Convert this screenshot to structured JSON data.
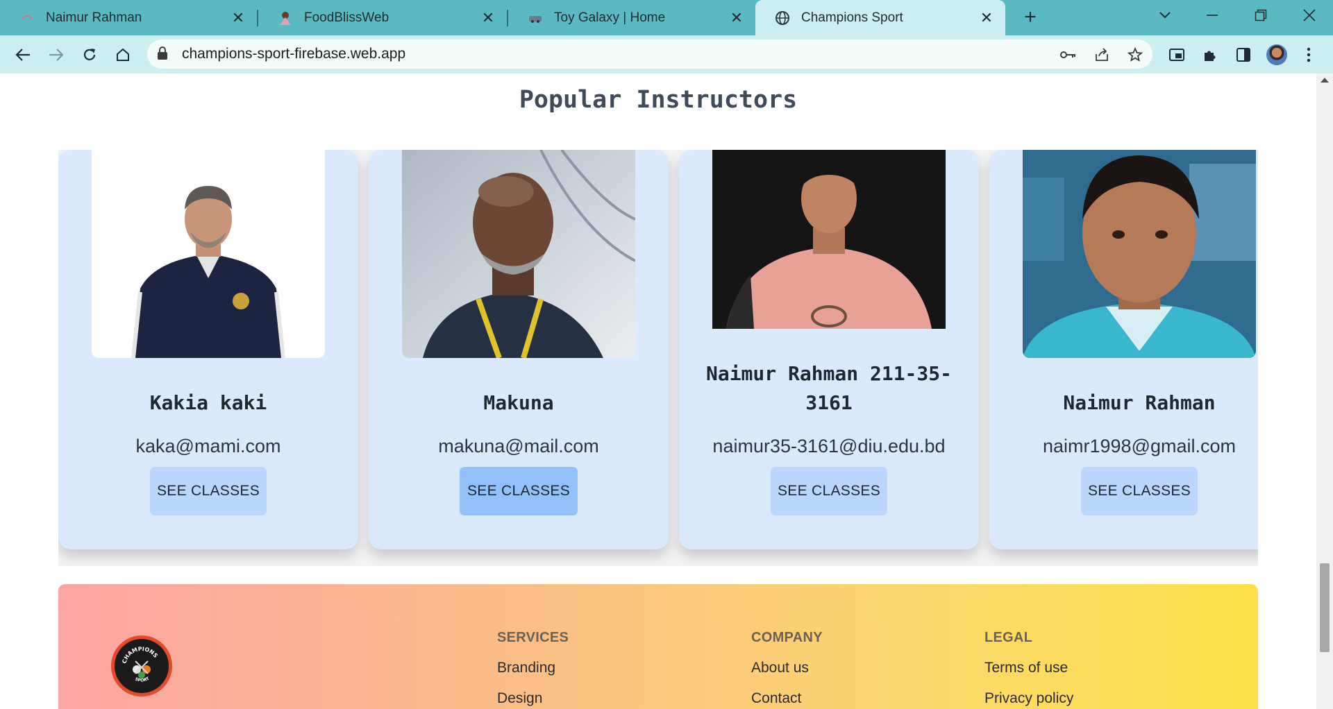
{
  "browser": {
    "tabs": [
      {
        "title": "Naimur Rahman",
        "active": false
      },
      {
        "title": "FoodBlissWeb",
        "active": false
      },
      {
        "title": "Toy Galaxy | Home",
        "active": false
      },
      {
        "title": "Champions Sport",
        "active": true
      }
    ],
    "url": "champions-sport-firebase.web.app"
  },
  "page": {
    "section_title": "Popular Instructors",
    "instructors": [
      {
        "name": "Kakia kaki",
        "email": "kaka@mami.com",
        "button": "SEE CLASSES"
      },
      {
        "name": "Makuna",
        "email": "makuna@mail.com",
        "button": "SEE CLASSES"
      },
      {
        "name": "Naimur Rahman 211-35-3161",
        "email": "naimur35-3161@diu.edu.bd",
        "button": "SEE CLASSES"
      },
      {
        "name": "Naimur Rahman",
        "email": "naimr1998@gmail.com",
        "button": "SEE CLASSES"
      }
    ],
    "slider": {
      "total_dots": 4,
      "active_index": 0
    }
  },
  "footer": {
    "logo_text": "CHAMPIONS SPORT",
    "columns": [
      {
        "heading": "SERVICES",
        "links": [
          "Branding",
          "Design"
        ]
      },
      {
        "heading": "COMPANY",
        "links": [
          "About us",
          "Contact"
        ]
      },
      {
        "heading": "LEGAL",
        "links": [
          "Terms of use",
          "Privacy policy"
        ]
      }
    ]
  },
  "colors": {
    "tab_strip": "#5bbac1",
    "toolbar": "#cdeef0",
    "card_bg": "#dbe9fd",
    "button_bg": "#bbd6fb",
    "button_active": "#93c2fa",
    "dot_active": "#2e8b60",
    "dot_inactive": "#aeb6c2"
  }
}
